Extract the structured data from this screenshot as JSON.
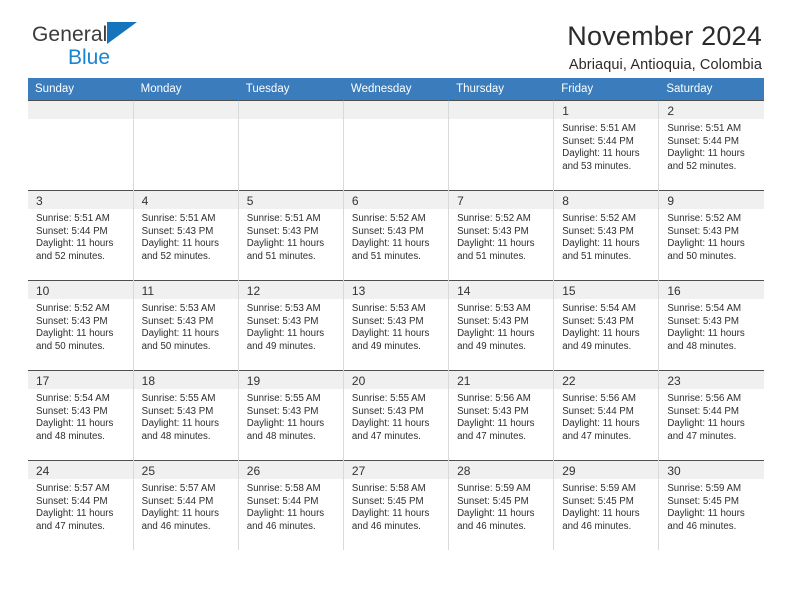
{
  "brand": {
    "name_part1": "General",
    "name_part2": "Blue",
    "accent_color": "#1b84d2"
  },
  "header": {
    "title": "November 2024",
    "subtitle": "Abriaqui, Antioquia, Colombia"
  },
  "calendar": {
    "header_color": "#3b7cbd",
    "weekdays": [
      "Sunday",
      "Monday",
      "Tuesday",
      "Wednesday",
      "Thursday",
      "Friday",
      "Saturday"
    ],
    "weeks": [
      [
        {
          "day": "",
          "sunrise": "",
          "sunset": "",
          "daylight1": "",
          "daylight2": "",
          "empty": true
        },
        {
          "day": "",
          "sunrise": "",
          "sunset": "",
          "daylight1": "",
          "daylight2": "",
          "empty": true
        },
        {
          "day": "",
          "sunrise": "",
          "sunset": "",
          "daylight1": "",
          "daylight2": "",
          "empty": true
        },
        {
          "day": "",
          "sunrise": "",
          "sunset": "",
          "daylight1": "",
          "daylight2": "",
          "empty": true
        },
        {
          "day": "",
          "sunrise": "",
          "sunset": "",
          "daylight1": "",
          "daylight2": "",
          "empty": true
        },
        {
          "day": "1",
          "sunrise": "Sunrise: 5:51 AM",
          "sunset": "Sunset: 5:44 PM",
          "daylight1": "Daylight: 11 hours",
          "daylight2": "and 53 minutes."
        },
        {
          "day": "2",
          "sunrise": "Sunrise: 5:51 AM",
          "sunset": "Sunset: 5:44 PM",
          "daylight1": "Daylight: 11 hours",
          "daylight2": "and 52 minutes."
        }
      ],
      [
        {
          "day": "3",
          "sunrise": "Sunrise: 5:51 AM",
          "sunset": "Sunset: 5:44 PM",
          "daylight1": "Daylight: 11 hours",
          "daylight2": "and 52 minutes."
        },
        {
          "day": "4",
          "sunrise": "Sunrise: 5:51 AM",
          "sunset": "Sunset: 5:43 PM",
          "daylight1": "Daylight: 11 hours",
          "daylight2": "and 52 minutes."
        },
        {
          "day": "5",
          "sunrise": "Sunrise: 5:51 AM",
          "sunset": "Sunset: 5:43 PM",
          "daylight1": "Daylight: 11 hours",
          "daylight2": "and 51 minutes."
        },
        {
          "day": "6",
          "sunrise": "Sunrise: 5:52 AM",
          "sunset": "Sunset: 5:43 PM",
          "daylight1": "Daylight: 11 hours",
          "daylight2": "and 51 minutes."
        },
        {
          "day": "7",
          "sunrise": "Sunrise: 5:52 AM",
          "sunset": "Sunset: 5:43 PM",
          "daylight1": "Daylight: 11 hours",
          "daylight2": "and 51 minutes."
        },
        {
          "day": "8",
          "sunrise": "Sunrise: 5:52 AM",
          "sunset": "Sunset: 5:43 PM",
          "daylight1": "Daylight: 11 hours",
          "daylight2": "and 51 minutes."
        },
        {
          "day": "9",
          "sunrise": "Sunrise: 5:52 AM",
          "sunset": "Sunset: 5:43 PM",
          "daylight1": "Daylight: 11 hours",
          "daylight2": "and 50 minutes."
        }
      ],
      [
        {
          "day": "10",
          "sunrise": "Sunrise: 5:52 AM",
          "sunset": "Sunset: 5:43 PM",
          "daylight1": "Daylight: 11 hours",
          "daylight2": "and 50 minutes."
        },
        {
          "day": "11",
          "sunrise": "Sunrise: 5:53 AM",
          "sunset": "Sunset: 5:43 PM",
          "daylight1": "Daylight: 11 hours",
          "daylight2": "and 50 minutes."
        },
        {
          "day": "12",
          "sunrise": "Sunrise: 5:53 AM",
          "sunset": "Sunset: 5:43 PM",
          "daylight1": "Daylight: 11 hours",
          "daylight2": "and 49 minutes."
        },
        {
          "day": "13",
          "sunrise": "Sunrise: 5:53 AM",
          "sunset": "Sunset: 5:43 PM",
          "daylight1": "Daylight: 11 hours",
          "daylight2": "and 49 minutes."
        },
        {
          "day": "14",
          "sunrise": "Sunrise: 5:53 AM",
          "sunset": "Sunset: 5:43 PM",
          "daylight1": "Daylight: 11 hours",
          "daylight2": "and 49 minutes."
        },
        {
          "day": "15",
          "sunrise": "Sunrise: 5:54 AM",
          "sunset": "Sunset: 5:43 PM",
          "daylight1": "Daylight: 11 hours",
          "daylight2": "and 49 minutes."
        },
        {
          "day": "16",
          "sunrise": "Sunrise: 5:54 AM",
          "sunset": "Sunset: 5:43 PM",
          "daylight1": "Daylight: 11 hours",
          "daylight2": "and 48 minutes."
        }
      ],
      [
        {
          "day": "17",
          "sunrise": "Sunrise: 5:54 AM",
          "sunset": "Sunset: 5:43 PM",
          "daylight1": "Daylight: 11 hours",
          "daylight2": "and 48 minutes."
        },
        {
          "day": "18",
          "sunrise": "Sunrise: 5:55 AM",
          "sunset": "Sunset: 5:43 PM",
          "daylight1": "Daylight: 11 hours",
          "daylight2": "and 48 minutes."
        },
        {
          "day": "19",
          "sunrise": "Sunrise: 5:55 AM",
          "sunset": "Sunset: 5:43 PM",
          "daylight1": "Daylight: 11 hours",
          "daylight2": "and 48 minutes."
        },
        {
          "day": "20",
          "sunrise": "Sunrise: 5:55 AM",
          "sunset": "Sunset: 5:43 PM",
          "daylight1": "Daylight: 11 hours",
          "daylight2": "and 47 minutes."
        },
        {
          "day": "21",
          "sunrise": "Sunrise: 5:56 AM",
          "sunset": "Sunset: 5:43 PM",
          "daylight1": "Daylight: 11 hours",
          "daylight2": "and 47 minutes."
        },
        {
          "day": "22",
          "sunrise": "Sunrise: 5:56 AM",
          "sunset": "Sunset: 5:44 PM",
          "daylight1": "Daylight: 11 hours",
          "daylight2": "and 47 minutes."
        },
        {
          "day": "23",
          "sunrise": "Sunrise: 5:56 AM",
          "sunset": "Sunset: 5:44 PM",
          "daylight1": "Daylight: 11 hours",
          "daylight2": "and 47 minutes."
        }
      ],
      [
        {
          "day": "24",
          "sunrise": "Sunrise: 5:57 AM",
          "sunset": "Sunset: 5:44 PM",
          "daylight1": "Daylight: 11 hours",
          "daylight2": "and 47 minutes."
        },
        {
          "day": "25",
          "sunrise": "Sunrise: 5:57 AM",
          "sunset": "Sunset: 5:44 PM",
          "daylight1": "Daylight: 11 hours",
          "daylight2": "and 46 minutes."
        },
        {
          "day": "26",
          "sunrise": "Sunrise: 5:58 AM",
          "sunset": "Sunset: 5:44 PM",
          "daylight1": "Daylight: 11 hours",
          "daylight2": "and 46 minutes."
        },
        {
          "day": "27",
          "sunrise": "Sunrise: 5:58 AM",
          "sunset": "Sunset: 5:45 PM",
          "daylight1": "Daylight: 11 hours",
          "daylight2": "and 46 minutes."
        },
        {
          "day": "28",
          "sunrise": "Sunrise: 5:59 AM",
          "sunset": "Sunset: 5:45 PM",
          "daylight1": "Daylight: 11 hours",
          "daylight2": "and 46 minutes."
        },
        {
          "day": "29",
          "sunrise": "Sunrise: 5:59 AM",
          "sunset": "Sunset: 5:45 PM",
          "daylight1": "Daylight: 11 hours",
          "daylight2": "and 46 minutes."
        },
        {
          "day": "30",
          "sunrise": "Sunrise: 5:59 AM",
          "sunset": "Sunset: 5:45 PM",
          "daylight1": "Daylight: 11 hours",
          "daylight2": "and 46 minutes."
        }
      ]
    ]
  }
}
